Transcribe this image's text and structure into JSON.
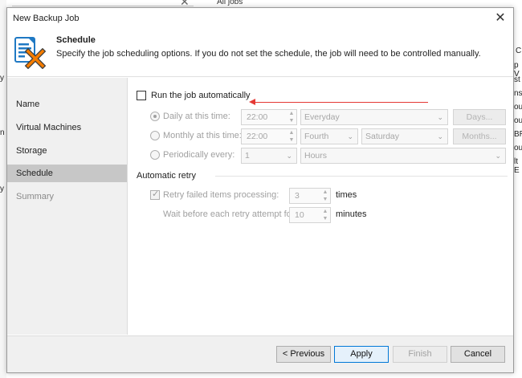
{
  "background": {
    "all_jobs_label": "All jobs",
    "right_fragments": [
      "C",
      "p V",
      "st",
      "nst",
      "ou",
      "ou",
      "BR/",
      "ou",
      "lt E"
    ],
    "left_fragments": [
      "y",
      "n",
      "y"
    ]
  },
  "dialog": {
    "title": "New Backup Job",
    "close_glyph": "✕"
  },
  "header": {
    "icon": "backup-job-icon",
    "title": "Schedule",
    "description": "Specify the job scheduling options. If you do not set the schedule, the job will need to be controlled manually."
  },
  "sidebar": {
    "items": [
      {
        "label": "Name",
        "state": "normal"
      },
      {
        "label": "Virtual Machines",
        "state": "normal"
      },
      {
        "label": "Storage",
        "state": "normal"
      },
      {
        "label": "Schedule",
        "state": "active"
      },
      {
        "label": "Summary",
        "state": "disabled"
      }
    ]
  },
  "schedule": {
    "run_auto_label": "Run the job automatically",
    "run_auto_checked": false,
    "daily": {
      "label": "Daily at this time:",
      "time": "22:00",
      "day_option": "Everyday",
      "button": "Days...",
      "selected": true
    },
    "monthly": {
      "label": "Monthly at this time:",
      "time": "22:00",
      "week_option": "Fourth",
      "weekday_option": "Saturday",
      "button": "Months...",
      "selected": false
    },
    "periodically": {
      "label": "Periodically every:",
      "count": "1",
      "unit": "Hours",
      "selected": false
    }
  },
  "retry": {
    "section_label": "Automatic retry",
    "retry_label": "Retry failed items processing:",
    "retry_checked": true,
    "retry_count": "3",
    "retry_unit": "times",
    "wait_label": "Wait before each retry attempt for:",
    "wait_value": "10",
    "wait_unit": "minutes"
  },
  "footer": {
    "previous": "< Previous",
    "apply": "Apply",
    "finish": "Finish",
    "cancel": "Cancel"
  },
  "colors": {
    "annotation_arrow": "#e53935",
    "primary_border": "#0078d7",
    "icon_blue": "#1f79c4",
    "icon_orange": "#f57c00"
  }
}
